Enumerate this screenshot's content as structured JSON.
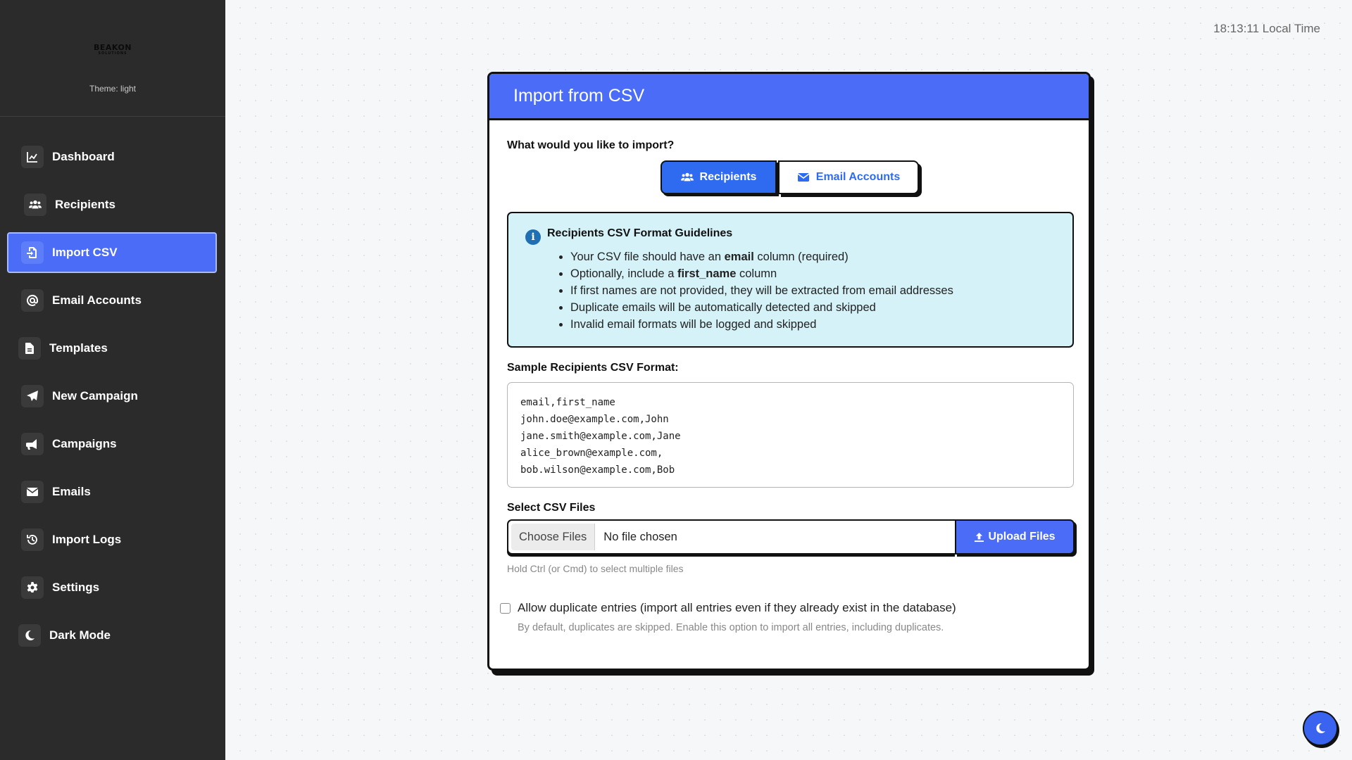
{
  "sidebar": {
    "logo_line1": "BEAKON",
    "logo_line2": "SOLUTIONS",
    "theme_label": "Theme: light",
    "items": [
      {
        "label": "Dashboard",
        "icon": "chart-line-icon"
      },
      {
        "label": "Recipients",
        "icon": "users-icon"
      },
      {
        "label": "Import CSV",
        "icon": "file-import-icon",
        "active": true
      },
      {
        "label": "Email Accounts",
        "icon": "at-sign-icon"
      },
      {
        "label": "Templates",
        "icon": "file-icon"
      },
      {
        "label": "New Campaign",
        "icon": "paper-plane-icon"
      },
      {
        "label": "Campaigns",
        "icon": "bullhorn-icon"
      },
      {
        "label": "Emails",
        "icon": "envelope-icon"
      },
      {
        "label": "Import Logs",
        "icon": "history-icon"
      },
      {
        "label": "Settings",
        "icon": "gear-icon"
      },
      {
        "label": "Dark Mode",
        "icon": "moon-icon"
      }
    ]
  },
  "clock": "18:13:11 Local Time",
  "card": {
    "title": "Import from CSV",
    "question": "What would you like to import?",
    "toggle": {
      "recipients": "Recipients",
      "email_accounts": "Email Accounts",
      "selected": "Recipients"
    },
    "guidelines": {
      "title": "Recipients CSV Format Guidelines",
      "items": [
        {
          "pre": "Your CSV file should have an ",
          "bold": "email",
          "post": " column (required)"
        },
        {
          "pre": "Optionally, include a ",
          "bold": "first_name",
          "post": " column"
        },
        {
          "pre": "If first names are not provided, they will be extracted from email addresses",
          "bold": "",
          "post": ""
        },
        {
          "pre": "Duplicate emails will be automatically detected and skipped",
          "bold": "",
          "post": ""
        },
        {
          "pre": "Invalid email formats will be logged and skipped",
          "bold": "",
          "post": ""
        }
      ]
    },
    "sample_label": "Sample Recipients CSV Format:",
    "sample_lines": [
      "email,first_name",
      "john.doe@example.com,John",
      "jane.smith@example.com,Jane",
      "alice_brown@example.com,",
      "bob.wilson@example.com,Bob"
    ],
    "files_label": "Select CSV Files",
    "choose_files": "Choose Files",
    "no_file": "No file chosen",
    "upload_label": "Upload Files",
    "hint": "Hold Ctrl (or Cmd) to select multiple files",
    "duplicate_label": "Allow duplicate entries (import all entries even if they already exist in the database)",
    "duplicate_checked": false,
    "duplicate_help": "By default, duplicates are skipped. Enable this option to import all entries, including duplicates."
  },
  "colors": {
    "accent": "#4a6cf7",
    "sidebar_bg": "#2b2b2b",
    "info_bg": "#d4f2f8"
  }
}
